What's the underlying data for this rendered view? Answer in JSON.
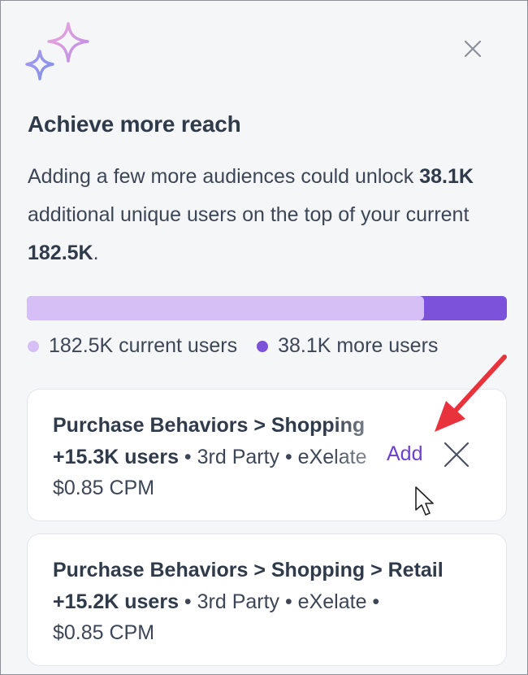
{
  "header": {
    "sparkle_icon": "sparkle-icon",
    "close_icon": "close-icon",
    "title": "Achieve more reach"
  },
  "description": {
    "part1": "Adding a few more audiences could unlock ",
    "additional_users": "38.1K",
    "part2": " additional unique users on the top of your current ",
    "current_users": "182.5K",
    "part3": "."
  },
  "reach_bar": {
    "current_fraction": 0.827,
    "current_color": "#d6bff5",
    "more_color": "#7b52d9"
  },
  "legend": {
    "current_label": "182.5K current users",
    "more_label": "38.1K more users"
  },
  "suggestions": [
    {
      "title": "Purchase Behaviors > Shopping",
      "users": "+15.3K users",
      "meta": " • 3rd Party • eXelate",
      "price": "$0.85 CPM",
      "add_label": "Add",
      "dismiss_icon": "close-icon"
    },
    {
      "title": "Purchase Behaviors > Shopping > Retail",
      "users": "+15.2K users",
      "meta": " • 3rd Party • eXelate •",
      "price": "$0.85 CPM"
    }
  ],
  "colors": {
    "accent": "#6a3fd1",
    "annotation_arrow": "#e8323c"
  }
}
